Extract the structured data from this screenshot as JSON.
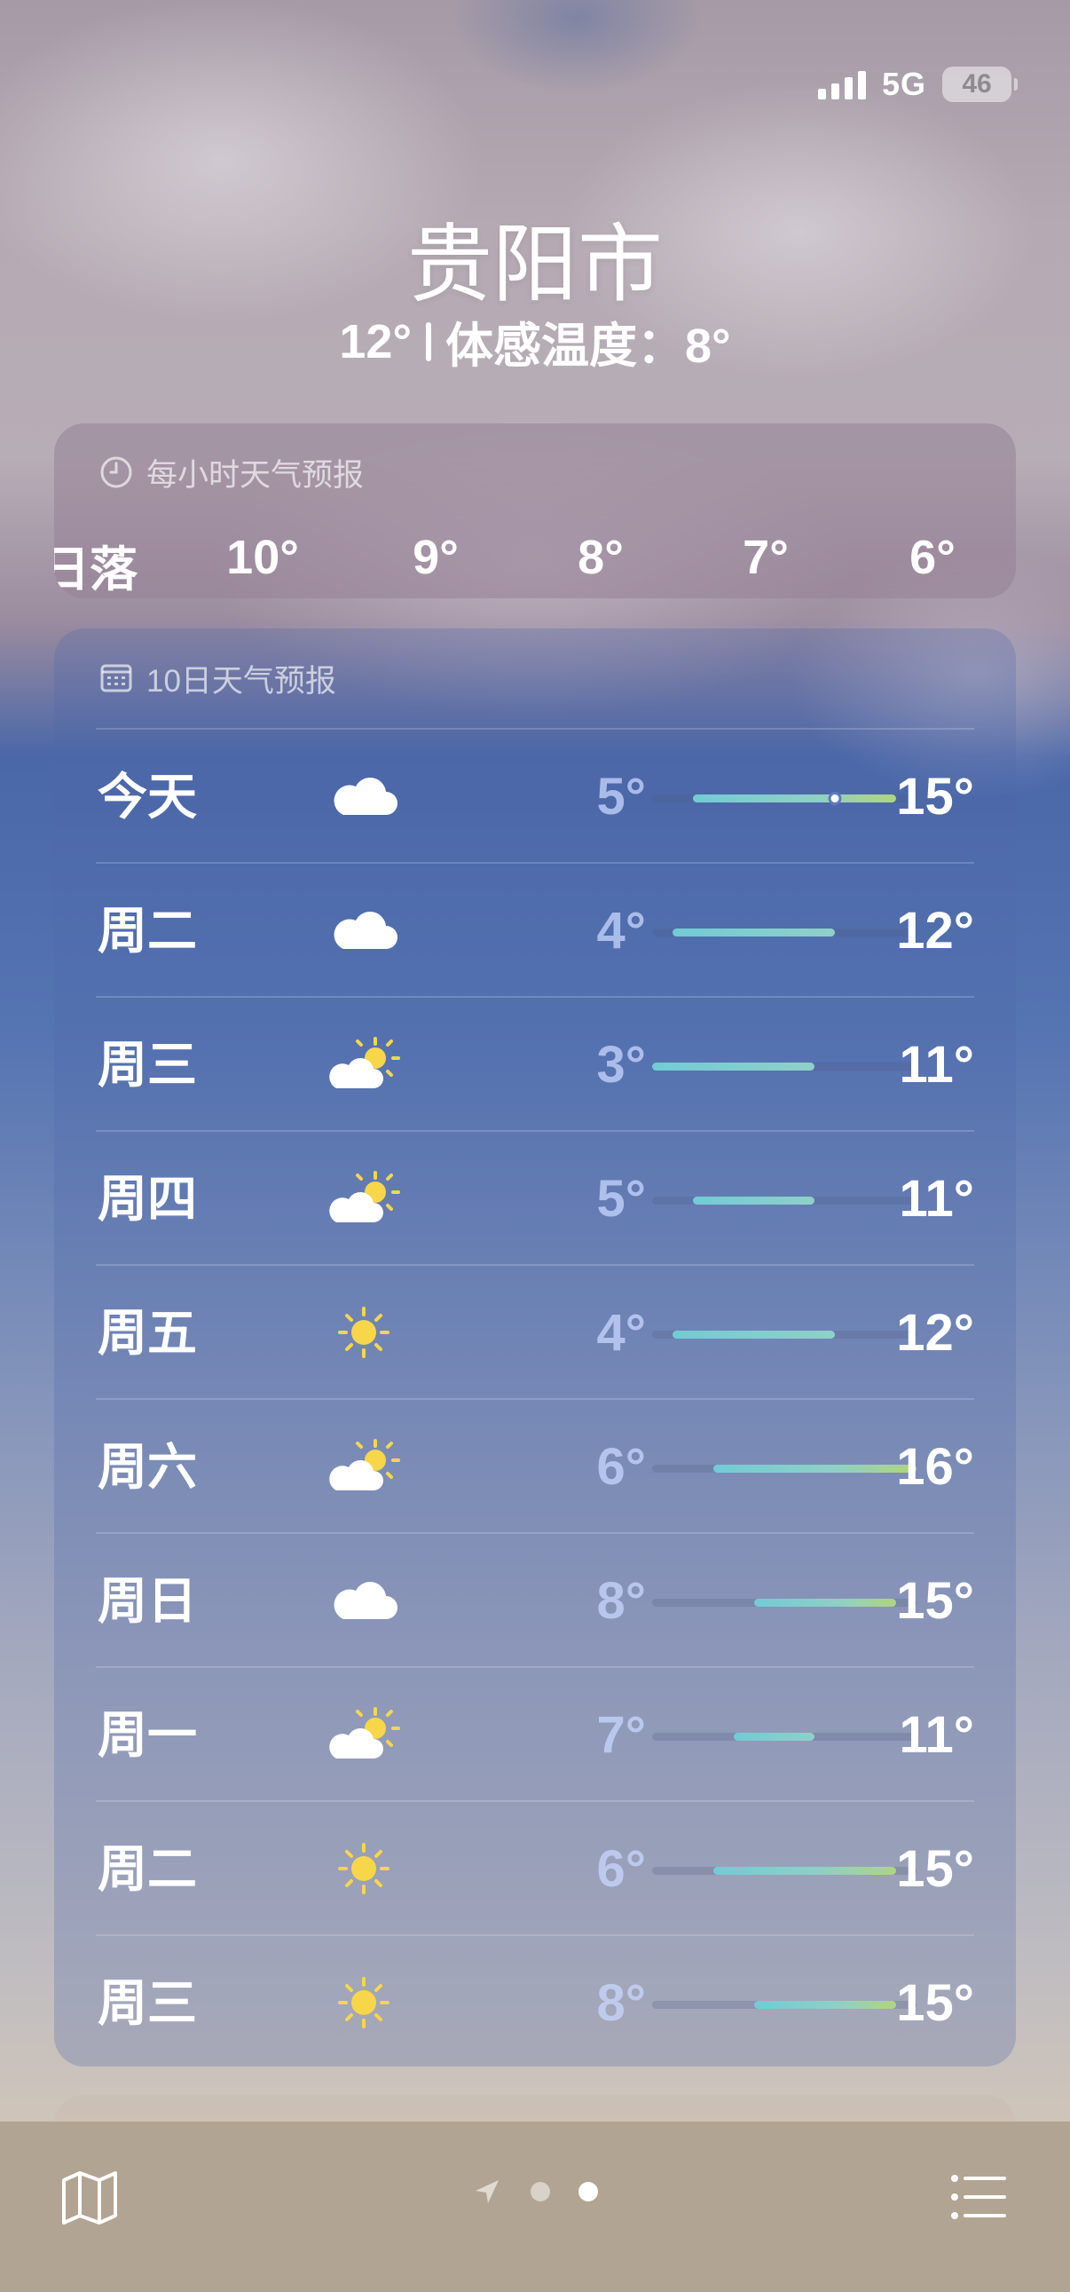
{
  "status_bar": {
    "network": "5G",
    "battery": "46"
  },
  "header": {
    "city": "贵阳市",
    "current_temp": "12°",
    "feels_like": "体感温度：8°"
  },
  "hourly": {
    "title": "每小时天气预报",
    "items": [
      "日落",
      "10°",
      "9°",
      "8°",
      "7°",
      "6°"
    ]
  },
  "daily": {
    "title": "10日天气预报",
    "range_min": 3,
    "range_max": 16,
    "current_temp": 12,
    "rows": [
      {
        "day": "今天",
        "icon": "cloud-icon",
        "low": "5°",
        "high": "15°",
        "lo": 5,
        "hi": 15,
        "current": true
      },
      {
        "day": "周二",
        "icon": "cloud-icon",
        "low": "4°",
        "high": "12°",
        "lo": 4,
        "hi": 12
      },
      {
        "day": "周三",
        "icon": "partly-sunny-icon",
        "low": "3°",
        "high": "11°",
        "lo": 3,
        "hi": 11
      },
      {
        "day": "周四",
        "icon": "partly-sunny-icon",
        "low": "5°",
        "high": "11°",
        "lo": 5,
        "hi": 11
      },
      {
        "day": "周五",
        "icon": "sun-icon",
        "low": "4°",
        "high": "12°",
        "lo": 4,
        "hi": 12
      },
      {
        "day": "周六",
        "icon": "partly-sunny-icon",
        "low": "6°",
        "high": "16°",
        "lo": 6,
        "hi": 16
      },
      {
        "day": "周日",
        "icon": "cloud-icon",
        "low": "8°",
        "high": "15°",
        "lo": 8,
        "hi": 15
      },
      {
        "day": "周一",
        "icon": "partly-sunny-icon",
        "low": "7°",
        "high": "11°",
        "lo": 7,
        "hi": 11
      },
      {
        "day": "周二",
        "icon": "sun-icon",
        "low": "6°",
        "high": "15°",
        "lo": 6,
        "hi": 15
      },
      {
        "day": "周三",
        "icon": "sun-icon",
        "low": "8°",
        "high": "15°",
        "lo": 8,
        "hi": 15
      }
    ]
  },
  "toolbar": {
    "map_icon": "map-icon",
    "location_icon": "location-arrow-icon",
    "list_icon": "list-icon",
    "pages": 2,
    "active_page": 2
  }
}
